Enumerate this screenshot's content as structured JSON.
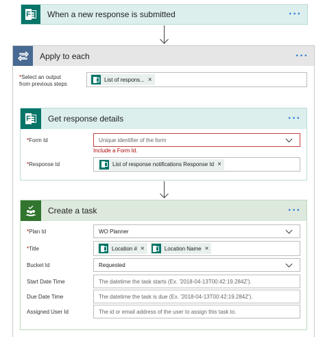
{
  "trigger": {
    "title": "When a new response is submitted",
    "menu_dots": "···"
  },
  "apply_each": {
    "title": "Apply to each",
    "menu_dots": "···",
    "select_label_line1": "Select an output",
    "select_label_line2": "from previous steps",
    "required_mark": "*",
    "chip_label": "List of respons...",
    "chip_remove": "×"
  },
  "get_details": {
    "title": "Get response details",
    "menu_dots": "···",
    "form_id_label": "Form Id",
    "form_id_placeholder": "Unique identifier of the form",
    "form_id_error": "Include a Form Id.",
    "response_id_label": "Response Id",
    "response_id_chip": "List of response notifications Response Id",
    "chip_remove": "×",
    "required_mark": "*"
  },
  "create_task": {
    "title": "Create a task",
    "menu_dots": "···",
    "required_mark": "*",
    "plan_id_label": "Plan Id",
    "plan_id_value": "WO Planner",
    "title_label": "Title",
    "title_chips": [
      "Location #",
      "Location Name"
    ],
    "chip_remove": "×",
    "bucket_id_label": "Bucket Id",
    "bucket_id_value": "Requested",
    "start_date_label": "Start Date Time",
    "start_date_placeholder": "The datetime the task starts (Ex. '2018-04-13T00:42:19.284Z').",
    "due_date_label": "Due Date Time",
    "due_date_placeholder": "The datetime the task is due (Ex. '2018-04-13T00:42:19.284Z').",
    "assigned_label": "Assigned User Id",
    "assigned_placeholder": "The id or email address of the user to assign this task to."
  },
  "colors": {
    "forms_green": "#077568",
    "loop_gray": "#486991",
    "planner_green": "#31752f",
    "error_red": "#a80000",
    "dots_blue": "#2b7bd1"
  }
}
